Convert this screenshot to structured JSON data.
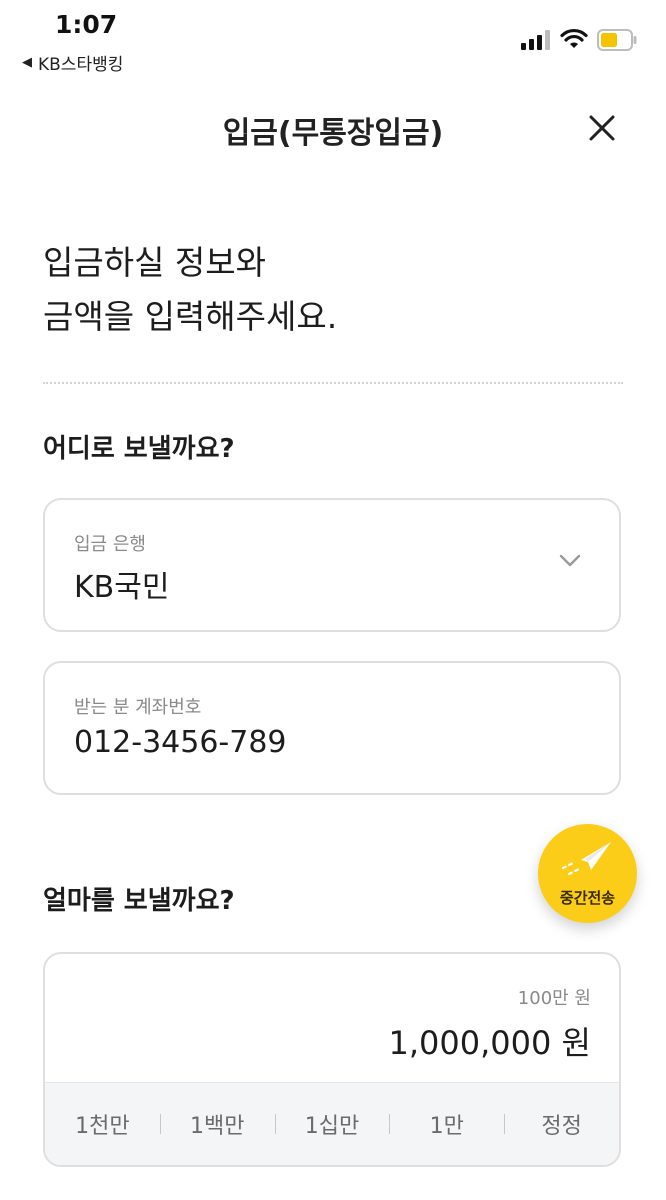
{
  "status_bar": {
    "time": "1:07",
    "back_app": "KB스타뱅킹",
    "back_glyph": "◀"
  },
  "header": {
    "title": "입금(무통장입금)"
  },
  "intro": {
    "line1": "입금하실 정보와",
    "line2": "금액을 입력해주세요."
  },
  "destination": {
    "question": "어디로 보낼까요?",
    "bank": {
      "label": "입금 은행",
      "value": "KB국민"
    },
    "account": {
      "label": "받는 분 계좌번호",
      "value": "012-3456-789"
    }
  },
  "amount": {
    "question": "얼마를 보낼까요?",
    "hint": "100만 원",
    "value": "1,000,000 원",
    "quick_buttons": [
      "1천만",
      "1백만",
      "1십만",
      "1만",
      "정정"
    ]
  },
  "fab": {
    "label": "중간전송"
  },
  "colors": {
    "accent": "#fbcc18",
    "battery": "#f5c400"
  }
}
